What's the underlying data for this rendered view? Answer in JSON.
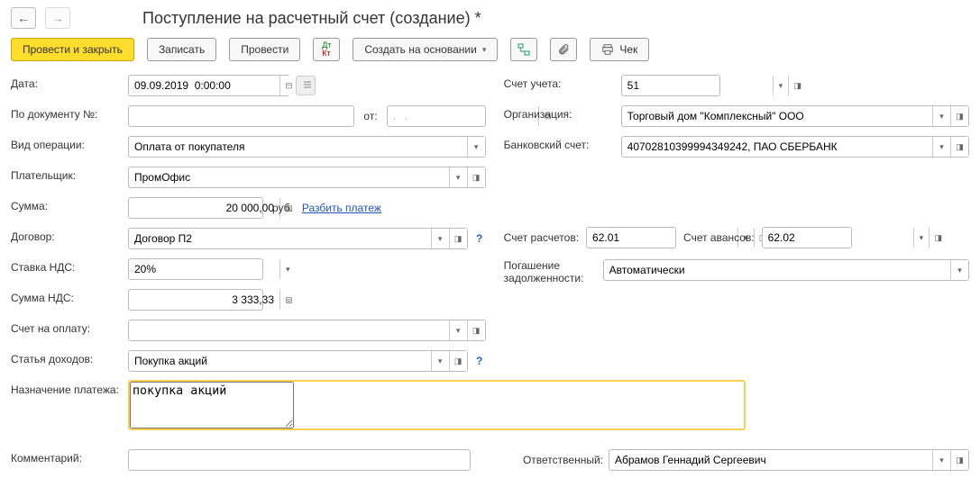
{
  "title": "Поступление на расчетный счет (создание) *",
  "toolbar": {
    "post_close": "Провести и закрыть",
    "write": "Записать",
    "post": "Провести",
    "create_based": "Создать на основании",
    "cheque": "Чек"
  },
  "labels": {
    "date": "Дата:",
    "doc_no": "По документу №:",
    "from": "от:",
    "op_type": "Вид операции:",
    "payer": "Плательщик:",
    "amount": "Сумма:",
    "rub": "руб.",
    "split": "Разбить платеж",
    "contract": "Договор:",
    "vat_rate": "Ставка НДС:",
    "vat_amount": "Сумма НДС:",
    "invoice": "Счет на оплату:",
    "income_item": "Статья доходов:",
    "purpose": "Назначение платежа:",
    "comment": "Комментарий:",
    "account_code": "Счет учета:",
    "org": "Организация:",
    "bank_account": "Банковский счет:",
    "settle_account": "Счет расчетов:",
    "advance_account": "Счет авансов:",
    "repayment": "Погашение задолженности:",
    "responsible": "Ответственный:"
  },
  "values": {
    "date": "09.09.2019  0:00:00",
    "doc_no": "",
    "from": ".   .",
    "op_type": "Оплата от покупателя",
    "payer": "ПромОфис",
    "amount": "20 000,00",
    "contract": "Договор П2",
    "vat_rate": "20%",
    "vat_amount": "3 333,33",
    "invoice": "",
    "income_item": "Покупка акций",
    "purpose": "покупка акций",
    "comment": "",
    "account_code": "51",
    "org": "Торговый дом \"Комплексный\" ООО",
    "bank_account": "40702810399994349242, ПАО СБЕРБАНК",
    "settle_account": "62.01",
    "advance_account": "62.02",
    "repayment": "Автоматически",
    "responsible": "Абрамов Геннадий Сергеевич"
  }
}
